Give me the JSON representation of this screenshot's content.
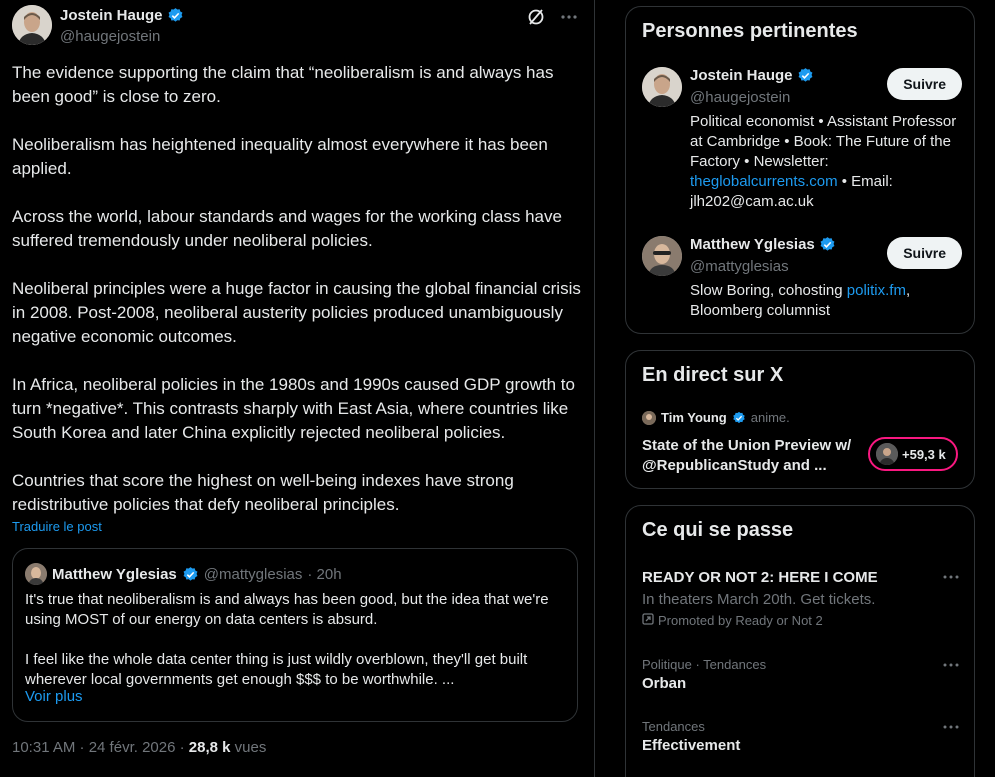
{
  "tweet": {
    "author_name": "Jostein Hauge",
    "author_handle": "@haugejostein",
    "paragraphs": [
      "The evidence supporting the claim that “neoliberalism is and always has been good” is close to zero.",
      "Neoliberalism has heightened inequality almost everywhere it has been applied.",
      "Across the world, labour standards and wages for the working class have suffered tremendously under neoliberal policies.",
      "Neoliberal principles were a huge factor in causing the global financial crisis in 2008. Post-2008, neoliberal austerity policies produced unambiguously negative economic outcomes.",
      "In Africa, neoliberal policies in the 1980s and 1990s caused GDP growth to turn *negative*. This contrasts sharply with East Asia, where countries like South Korea and later China explicitly rejected neoliberal policies.",
      "Countries that score the highest on well-being indexes have strong redistributive policies that defy neoliberal principles."
    ],
    "translate_label": "Traduire le post",
    "time": "10:31 AM · 24 févr. 2026 · ",
    "views_count": "28,8 k",
    "views_label": " vues"
  },
  "quote": {
    "author_name": "Matthew Yglesias",
    "author_handle": "@mattyglesias",
    "age": "· 20h",
    "paragraphs": [
      "It's true that neoliberalism is and always has been good, but the idea that we're using MOST of our energy on data centers is absurd.",
      "I feel like the whole data center thing is just wildly overblown, they'll get built wherever local governments get enough $$$ to be worthwhile. ..."
    ],
    "more_label": "Voir plus"
  },
  "relevant": {
    "title": "Personnes pertinentes",
    "people": [
      {
        "name": "Jostein Hauge",
        "handle": "@haugejostein",
        "bio_before": "Political economist • Assistant Professor at Cambridge • Book: The Future of the Factory • Newsletter: ",
        "bio_link": "theglobalcurrents.com",
        "bio_after": " • Email: jlh202@cam.ac.uk",
        "follow_label": "Suivre"
      },
      {
        "name": "Matthew Yglesias",
        "handle": "@mattyglesias",
        "bio_before": "Slow Boring, cohosting ",
        "bio_link": "politix.fm",
        "bio_after": ", Bloomberg columnist",
        "follow_label": "Suivre"
      }
    ]
  },
  "live": {
    "title": "En direct sur X",
    "host": "Tim Young",
    "status": "anime.",
    "space_title": "State of the Union Preview w/ @RepublicanStudy and ...",
    "listeners": "+59,3 k"
  },
  "happening": {
    "title": "Ce qui se passe",
    "items": [
      {
        "main": "READY OR NOT 2: HERE I COME",
        "desc": "In theaters March 20th. Get tickets.",
        "promo": "Promoted by Ready or Not 2"
      },
      {
        "sub": "Politique · Tendances",
        "main": "Orban"
      },
      {
        "sub": "Tendances",
        "main": "Effectivement"
      }
    ]
  },
  "colors": {
    "accent": "#1d9bf0",
    "live_ring": "#f91880",
    "border": "#2f3336",
    "muted": "#71767b"
  }
}
